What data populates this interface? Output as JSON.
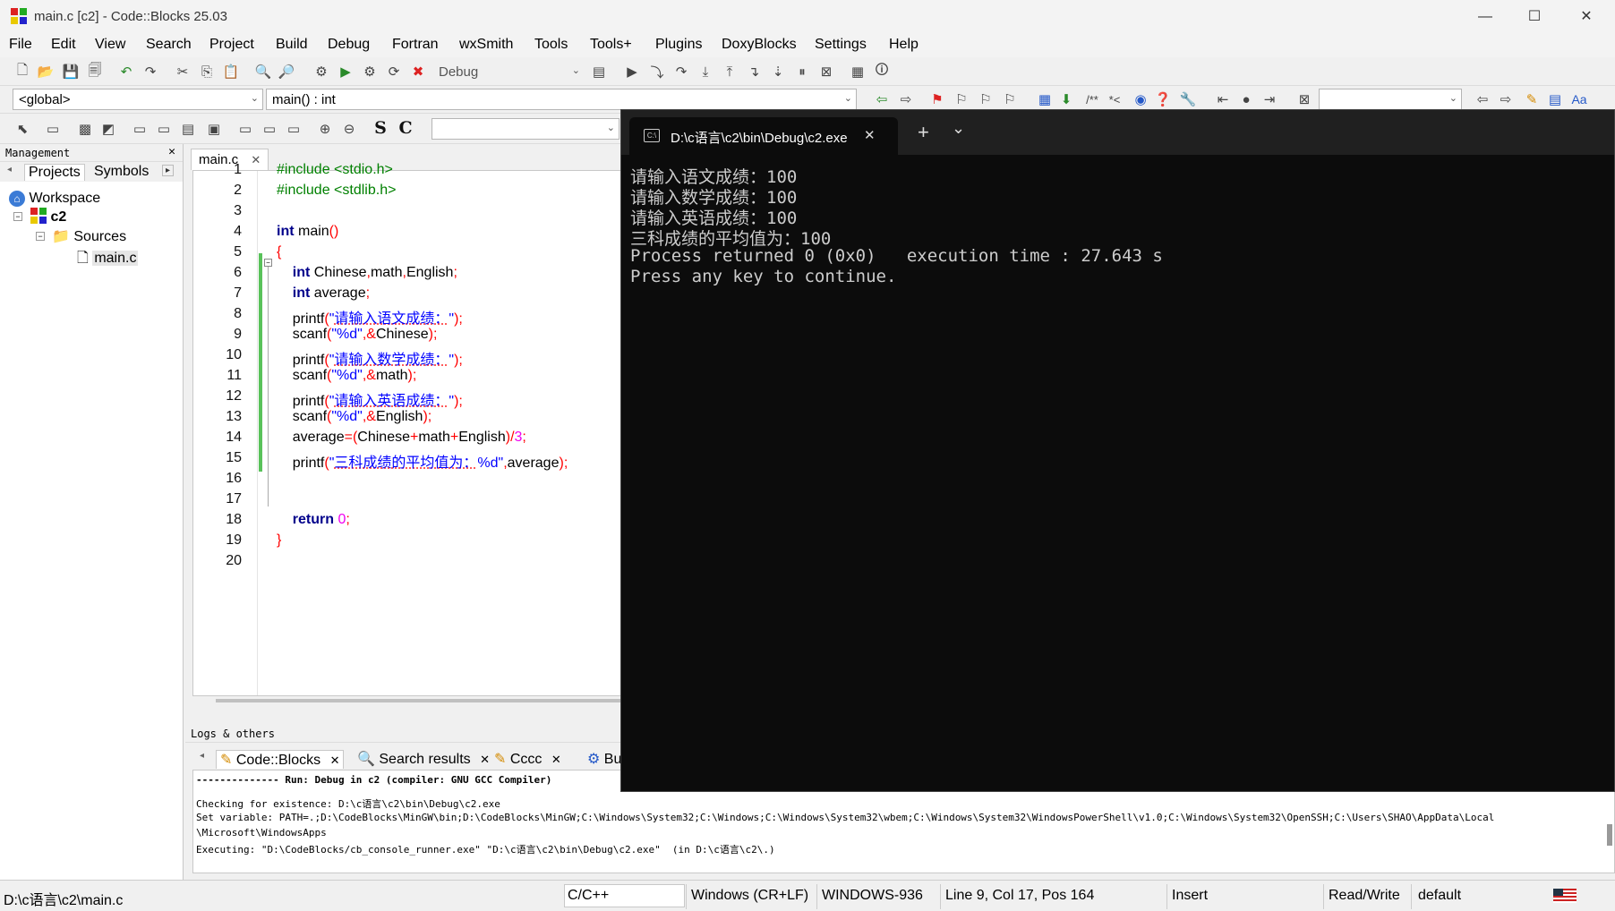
{
  "window": {
    "title": "main.c [c2] - Code::Blocks 25.03",
    "minimize": "—",
    "maximize": "☐",
    "close": "✕"
  },
  "menu": [
    "File",
    "Edit",
    "View",
    "Search",
    "Project",
    "Build",
    "Debug",
    "Fortran",
    "wxSmith",
    "Tools",
    "Tools+",
    "Plugins",
    "DoxyBlocks",
    "Settings",
    "Help"
  ],
  "toolbar": {
    "build_target": "Debug",
    "scope": "<global>",
    "function": "main() : int",
    "comment_glyph": "/**",
    "uncomment_glyph": "*<",
    "bold_s": "S",
    "bold_c": "C",
    "aa": "Aa"
  },
  "management": {
    "header": "Management",
    "tabs": [
      "Projects",
      "Symbols"
    ],
    "tree": {
      "workspace": "Workspace",
      "project": "c2",
      "folder": "Sources",
      "file": "main.c"
    }
  },
  "editor": {
    "tab": "main.c",
    "line_numbers": [
      "1",
      "2",
      "3",
      "4",
      "5",
      "6",
      "7",
      "8",
      "9",
      "10",
      "11",
      "12",
      "13",
      "14",
      "15",
      "16",
      "17",
      "18",
      "19",
      "20"
    ],
    "code": [
      [
        "pp:#include <stdio.h>"
      ],
      [
        "pp:#include <stdlib.h>"
      ],
      [],
      [
        "kw:int",
        " main",
        "op:()"
      ],
      [
        "op:{"
      ],
      [
        "    ",
        "kw:int",
        " Chinese",
        "op:,",
        "math",
        "op:,",
        "English",
        "op:;"
      ],
      [
        "    ",
        "kw:int",
        " average",
        "op:;"
      ],
      [
        "    printf",
        "op:(",
        "str:\"",
        "cn:请输入语文成绩：",
        "str:\"",
        "op:);"
      ],
      [
        "    scanf",
        "op:(",
        "str:\"%d\"",
        "op:,&",
        "Chinese",
        "op:);"
      ],
      [
        "    printf",
        "op:(",
        "str:\"",
        "cn:请输入数学成绩：",
        "str:\"",
        "op:);"
      ],
      [
        "    scanf",
        "op:(",
        "str:\"%d\"",
        "op:,&",
        "math",
        "op:);"
      ],
      [
        "    printf",
        "op:(",
        "str:\"",
        "cn:请输入英语成绩：",
        "str:\"",
        "op:);"
      ],
      [
        "    scanf",
        "op:(",
        "str:\"%d\"",
        "op:,&",
        "English",
        "op:);"
      ],
      [
        "    average",
        "op:=(",
        "Chinese",
        "op:+",
        "math",
        "op:+",
        "English",
        "op:)/",
        "num:3",
        "op:;"
      ],
      [
        "    printf",
        "op:(",
        "str:\"",
        "cn:三科成绩的平均值为：",
        "str:%d\"",
        "op:,",
        "average",
        "op:);"
      ],
      [],
      [],
      [
        "    ",
        "kw:return",
        " ",
        "num:0",
        "op:;"
      ],
      [
        "op:}"
      ],
      []
    ]
  },
  "logs": {
    "header": "Logs & others",
    "tabs": [
      "Code::Blocks",
      "Search results",
      "Cccc",
      "Bui"
    ],
    "lines": [
      "-------------- Run: Debug in c2 (compiler: GNU GCC Compiler)",
      "Checking for existence: D:\\c语言\\c2\\bin\\Debug\\c2.exe",
      "Set variable: PATH=.;D:\\CodeBlocks\\MinGW\\bin;D:\\CodeBlocks\\MinGW;C:\\Windows\\System32;C:\\Windows;C:\\Windows\\System32\\wbem;C:\\Windows\\System32\\WindowsPowerShell\\v1.0;C:\\Windows\\System32\\OpenSSH;C:\\Users\\SHAO\\AppData\\Local",
      "\\Microsoft\\WindowsApps",
      "Executing: \"D:\\CodeBlocks/cb_console_runner.exe\" \"D:\\c语言\\c2\\bin\\Debug\\c2.exe\"  (in D:\\c语言\\c2\\.)"
    ]
  },
  "status": {
    "path": "D:\\c语言\\c2\\main.c",
    "language": "C/C++",
    "eol": "Windows (CR+LF)",
    "encoding": "WINDOWS-936",
    "position": "Line 9, Col 17, Pos 164",
    "mode": "Insert",
    "access": "Read/Write",
    "profile": "default"
  },
  "terminal": {
    "tab_title": "D:\\c语言\\c2\\bin\\Debug\\c2.exe",
    "new_tab": "+",
    "dropdown": "⌄",
    "lines": [
      "请输入语文成绩：100",
      "请输入数学成绩：100",
      "请输入英语成绩：100",
      "三科成绩的平均值为：100",
      "Process returned 0 (0x0)   execution time : 27.643 s",
      "Press any key to continue."
    ]
  }
}
